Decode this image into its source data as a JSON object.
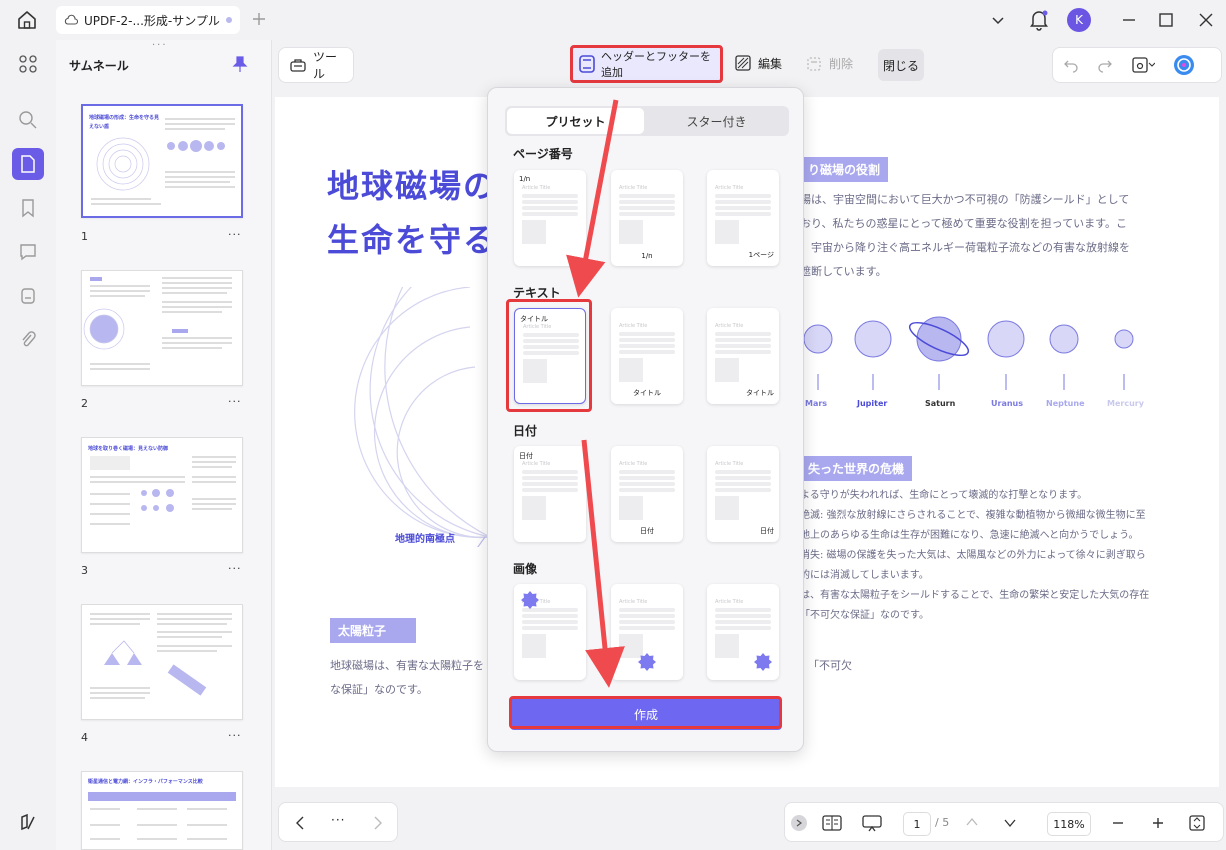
{
  "titlebar": {
    "tab_title": "UPDF-2-...形成-サンプル",
    "avatar_initial": "K"
  },
  "thumbs_panel": {
    "title": "サムネール",
    "pages": [
      {
        "num": "1",
        "heading": "地球磁場の形成：生命を守る見えない盾"
      },
      {
        "num": "2",
        "heading": ""
      },
      {
        "num": "3",
        "heading": "地球を取り巻く磁場：見えない防御"
      },
      {
        "num": "4",
        "heading": ""
      },
      {
        "num": "",
        "heading": "衛星通信と電力網：インフラ・パフォーマンス比較"
      }
    ],
    "more": "···"
  },
  "toolbar": {
    "tools_label": "ツール",
    "add_header_footer_label": "ヘッダーとフッターを追加",
    "edit_label": "編集",
    "delete_label": "削除",
    "close_label": "閉じる"
  },
  "document": {
    "title_line1": "地球磁場の",
    "title_line2": "生命を守る",
    "section_role": "り磁場の役割",
    "role_text": [
      "場は、宇宙空間において巨大かつ不可視の「防護シールド」として",
      "おり、私たちの惑星にとって極めて重要な役割を担っています。こ",
      "、宇宙から降り注ぐ高エネルギー荷電粒子流などの有害な放射線を",
      "遮断しています。"
    ],
    "planets": [
      "Mars",
      "Jupiter",
      "Saturn",
      "Uranus",
      "Neptune",
      "Mercury"
    ],
    "south_pole_label": "地理的南極点",
    "section_lost": "失った世界の危機",
    "lost_text": [
      "よる守りが失われれば、生命にとって壊滅的な打撃となります。",
      "絶滅: 強烈な放射線にさらされることで、複雑な動植物から微細な微生物に至",
      "地上のあらゆる生命は生存が困難になり、急速に絶滅へと向かうでしょう。",
      "消失: 磁場の保護を失った大気は、太陽風などの外力によって徐々に剥ぎ取ら",
      "的には消滅してしまいます。",
      "は、有害な太陽粒子をシールドすることで、生命の繁栄と安定した大気の存在",
      "「不可欠な保証」なのです。"
    ],
    "section_solar": "太陽粒子",
    "solar_text_1": "地球磁場は、有害な太陽粒子を",
    "solar_text_1b": "「不可欠",
    "solar_text_2": "な保証」なのです。"
  },
  "popup": {
    "tab_preset": "プリセット",
    "tab_starred": "スター付き",
    "sections": [
      {
        "title": "ページ番号",
        "cards": [
          {
            "tl": "1/n",
            "br": "",
            "bm": ""
          },
          {
            "tl": "",
            "br": "",
            "bm": "1/n"
          },
          {
            "tl": "",
            "br": "1ページ",
            "bm": ""
          }
        ]
      },
      {
        "title": "テキスト",
        "cards": [
          {
            "tl": "タイトル",
            "br": "",
            "bm": ""
          },
          {
            "tl": "",
            "br": "",
            "bm": "タイトル"
          },
          {
            "tl": "",
            "br": "タイトル",
            "bm": ""
          }
        ]
      },
      {
        "title": "日付",
        "cards": [
          {
            "tl": "日付",
            "br": "",
            "bm": ""
          },
          {
            "tl": "",
            "br": "",
            "bm": "日付"
          },
          {
            "tl": "",
            "br": "日付",
            "bm": ""
          }
        ]
      },
      {
        "title": "画像",
        "cards": [
          {
            "tl": "",
            "br": "",
            "bm": ""
          },
          {
            "tl": "",
            "br": "",
            "bm": ""
          },
          {
            "tl": "",
            "br": "",
            "bm": ""
          }
        ]
      }
    ],
    "article_title": "Article Title",
    "create_label": "作成"
  },
  "bottombar": {
    "more": "···",
    "page_current": "1",
    "page_total": "/ 5",
    "zoom": "118%"
  },
  "colors": {
    "accent": "#6b5ce7",
    "highlight": "#e5393e",
    "doc_title": "#4b4bd8"
  }
}
